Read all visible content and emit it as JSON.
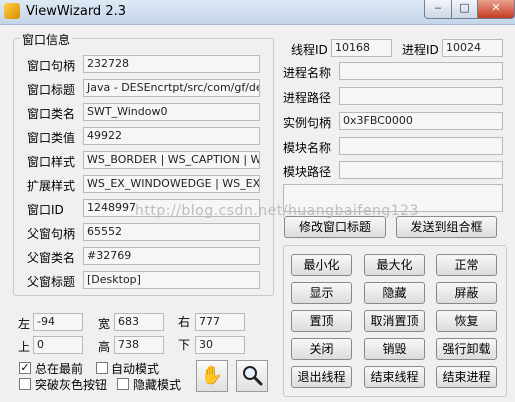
{
  "window": {
    "title": "ViewWizard 2.3",
    "min_glyph": "‒",
    "max_glyph": "□",
    "close_glyph": "✕"
  },
  "window_info": {
    "group_title": "窗口信息",
    "fields": [
      {
        "label": "窗口句柄",
        "value": "232728"
      },
      {
        "label": "窗口标题",
        "value": "Java - DESEncrtpt/src/com/gf/desen"
      },
      {
        "label": "窗口类名",
        "value": "SWT_Window0"
      },
      {
        "label": "窗口类值",
        "value": "49922"
      },
      {
        "label": "窗口样式",
        "value": "WS_BORDER | WS_CAPTION | WS_C"
      },
      {
        "label": "扩展样式",
        "value": "WS_EX_WINDOWEDGE | WS_EX_NO"
      },
      {
        "label": "窗口ID",
        "value": "1248997"
      },
      {
        "label": "父窗句柄",
        "value": "65552"
      },
      {
        "label": "父窗类名",
        "value": "#32769"
      },
      {
        "label": "父窗标题",
        "value": "[Desktop]"
      }
    ]
  },
  "process": {
    "thread_id_label": "线程ID",
    "thread_id": "10168",
    "process_id_label": "进程ID",
    "process_id": "10024",
    "rows": [
      {
        "label": "进程名称",
        "value": ""
      },
      {
        "label": "进程路径",
        "value": ""
      },
      {
        "label": "实例句柄",
        "value": "0x3FBC0000"
      },
      {
        "label": "模块名称",
        "value": ""
      },
      {
        "label": "模块路径",
        "value": ""
      }
    ],
    "modify_title_button": "修改窗口标题",
    "send_combo_button": "发送到组合框"
  },
  "actions": [
    [
      "最小化",
      "最大化",
      "正常"
    ],
    [
      "显示",
      "隐藏",
      "屏蔽"
    ],
    [
      "置顶",
      "取消置顶",
      "恢复"
    ],
    [
      "关闭",
      "销毁",
      "强行卸载"
    ],
    [
      "退出线程",
      "结束线程",
      "结束进程"
    ]
  ],
  "rect": {
    "left_label": "左",
    "left": "-94",
    "width_label": "宽",
    "width": "683",
    "right_label": "右",
    "right": "777",
    "top_label": "上",
    "top": "0",
    "height_label": "高",
    "height": "738",
    "bottom_label": "下",
    "bottom": "30"
  },
  "options": {
    "always_on_top": "总在最前",
    "always_on_top_checked": true,
    "auto_mode": "自动模式",
    "auto_mode_checked": false,
    "break_gray": "突破灰色按钮",
    "break_gray_checked": false,
    "hide_mode": "隐藏模式",
    "hide_mode_checked": false
  },
  "tools": {
    "hand_icon": "hand-icon",
    "hand_glyph": "✋",
    "magnifier_icon": "magnifier-icon"
  },
  "watermark": "http://blog.csdn.net/huangbaifeng123"
}
